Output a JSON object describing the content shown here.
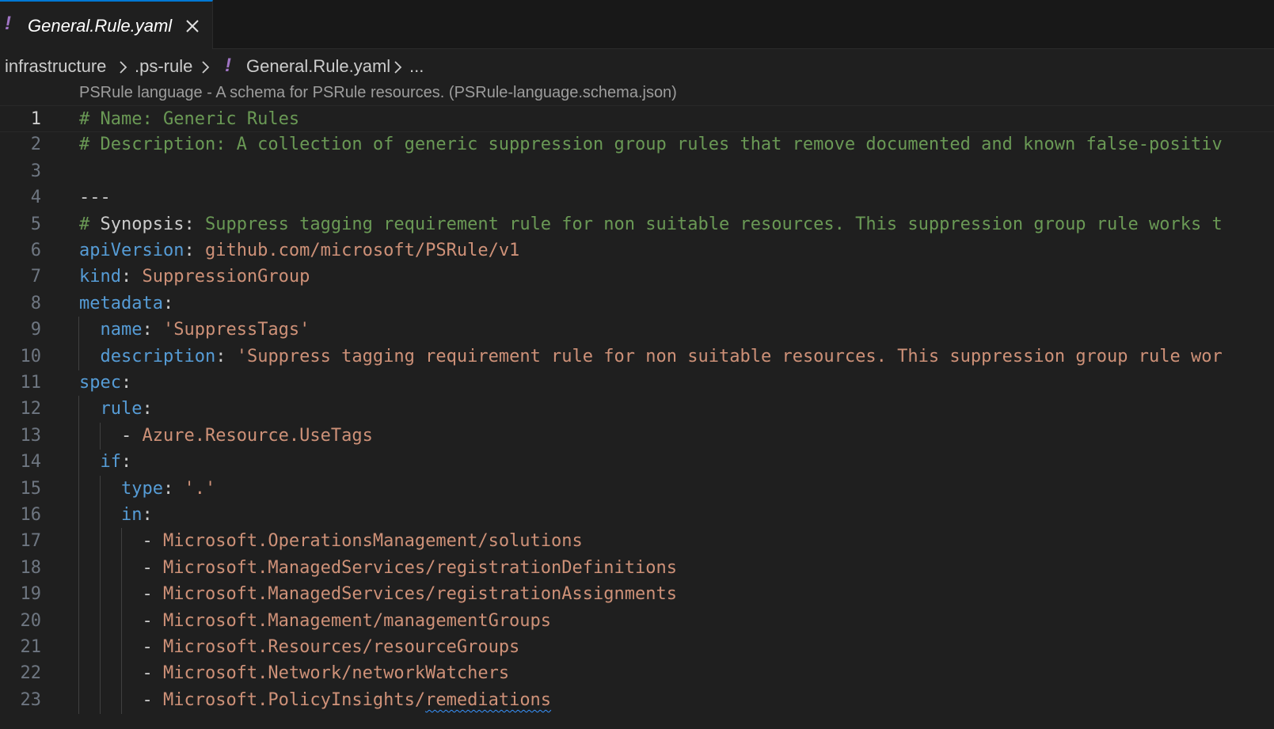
{
  "tab": {
    "icon": "!",
    "label": "General.Rule.yaml"
  },
  "breadcrumb": {
    "items": [
      "infrastructure",
      ".ps-rule",
      "General.Rule.yaml",
      "..."
    ],
    "file_icon": "!"
  },
  "schema_hint": "PSRule language - A schema for PSRule resources. (PSRule-language.schema.json)",
  "lines": [
    {
      "num": "1",
      "parts": [
        {
          "cls": "c-comment",
          "text": "# Name: Generic Rules"
        }
      ]
    },
    {
      "num": "2",
      "parts": [
        {
          "cls": "c-comment",
          "text": "# Description: A collection of generic suppression group rules that remove documented and known false-positiv"
        }
      ]
    },
    {
      "num": "3",
      "parts": []
    },
    {
      "num": "4",
      "parts": [
        {
          "cls": "c-plain",
          "text": "---"
        }
      ]
    },
    {
      "num": "5",
      "parts": [
        {
          "cls": "c-comment",
          "text": "# "
        },
        {
          "cls": "c-plain",
          "text": "Synopsis:"
        },
        {
          "cls": "c-comment",
          "text": " Suppress tagging requirement rule for non suitable resources. This suppression group rule works t"
        }
      ]
    },
    {
      "num": "6",
      "parts": [
        {
          "cls": "c-key",
          "text": "apiVersion"
        },
        {
          "cls": "c-plain",
          "text": ": "
        },
        {
          "cls": "c-str",
          "text": "github.com/microsoft/PSRule/v1"
        }
      ]
    },
    {
      "num": "7",
      "parts": [
        {
          "cls": "c-key",
          "text": "kind"
        },
        {
          "cls": "c-plain",
          "text": ": "
        },
        {
          "cls": "c-str",
          "text": "SuppressionGroup"
        }
      ]
    },
    {
      "num": "8",
      "parts": [
        {
          "cls": "c-key",
          "text": "metadata"
        },
        {
          "cls": "c-plain",
          "text": ":"
        }
      ]
    },
    {
      "num": "9",
      "parts": [
        {
          "cls": "c-plain",
          "text": "  "
        },
        {
          "cls": "c-key",
          "text": "name"
        },
        {
          "cls": "c-plain",
          "text": ": "
        },
        {
          "cls": "c-str",
          "text": "'SuppressTags'"
        }
      ]
    },
    {
      "num": "10",
      "parts": [
        {
          "cls": "c-plain",
          "text": "  "
        },
        {
          "cls": "c-key",
          "text": "description"
        },
        {
          "cls": "c-plain",
          "text": ": "
        },
        {
          "cls": "c-str",
          "text": "'Suppress tagging requirement rule for non suitable resources. This suppression group rule wor"
        }
      ]
    },
    {
      "num": "11",
      "parts": [
        {
          "cls": "c-key",
          "text": "spec"
        },
        {
          "cls": "c-plain",
          "text": ":"
        }
      ]
    },
    {
      "num": "12",
      "parts": [
        {
          "cls": "c-plain",
          "text": "  "
        },
        {
          "cls": "c-key",
          "text": "rule"
        },
        {
          "cls": "c-plain",
          "text": ":"
        }
      ]
    },
    {
      "num": "13",
      "parts": [
        {
          "cls": "c-plain",
          "text": "    - "
        },
        {
          "cls": "c-str",
          "text": "Azure.Resource.UseTags"
        }
      ]
    },
    {
      "num": "14",
      "parts": [
        {
          "cls": "c-plain",
          "text": "  "
        },
        {
          "cls": "c-key",
          "text": "if"
        },
        {
          "cls": "c-plain",
          "text": ":"
        }
      ]
    },
    {
      "num": "15",
      "parts": [
        {
          "cls": "c-plain",
          "text": "    "
        },
        {
          "cls": "c-key",
          "text": "type"
        },
        {
          "cls": "c-plain",
          "text": ": "
        },
        {
          "cls": "c-str",
          "text": "'.'"
        }
      ]
    },
    {
      "num": "16",
      "parts": [
        {
          "cls": "c-plain",
          "text": "    "
        },
        {
          "cls": "c-key",
          "text": "in"
        },
        {
          "cls": "c-plain",
          "text": ":"
        }
      ]
    },
    {
      "num": "17",
      "parts": [
        {
          "cls": "c-plain",
          "text": "      - "
        },
        {
          "cls": "c-str",
          "text": "Microsoft.OperationsManagement/solutions"
        }
      ]
    },
    {
      "num": "18",
      "parts": [
        {
          "cls": "c-plain",
          "text": "      - "
        },
        {
          "cls": "c-str",
          "text": "Microsoft.ManagedServices/registrationDefinitions"
        }
      ]
    },
    {
      "num": "19",
      "parts": [
        {
          "cls": "c-plain",
          "text": "      - "
        },
        {
          "cls": "c-str",
          "text": "Microsoft.ManagedServices/registrationAssignments"
        }
      ]
    },
    {
      "num": "20",
      "parts": [
        {
          "cls": "c-plain",
          "text": "      - "
        },
        {
          "cls": "c-str",
          "text": "Microsoft.Management/managementGroups"
        }
      ]
    },
    {
      "num": "21",
      "parts": [
        {
          "cls": "c-plain",
          "text": "      - "
        },
        {
          "cls": "c-str",
          "text": "Microsoft.Resources/resourceGroups"
        }
      ]
    },
    {
      "num": "22",
      "parts": [
        {
          "cls": "c-plain",
          "text": "      - "
        },
        {
          "cls": "c-str",
          "text": "Microsoft.Network/networkWatchers"
        }
      ]
    },
    {
      "num": "23",
      "parts": [
        {
          "cls": "c-plain",
          "text": "      - "
        },
        {
          "cls": "c-str",
          "text": "Microsoft.PolicyInsights/"
        },
        {
          "cls": "c-str squiggle",
          "text": "remediations"
        }
      ]
    }
  ],
  "colors": {
    "comment": "#6a9955",
    "key": "#569cd6",
    "string": "#ce9178",
    "accent": "#0078d4",
    "yaml_icon": "#a074c4"
  }
}
